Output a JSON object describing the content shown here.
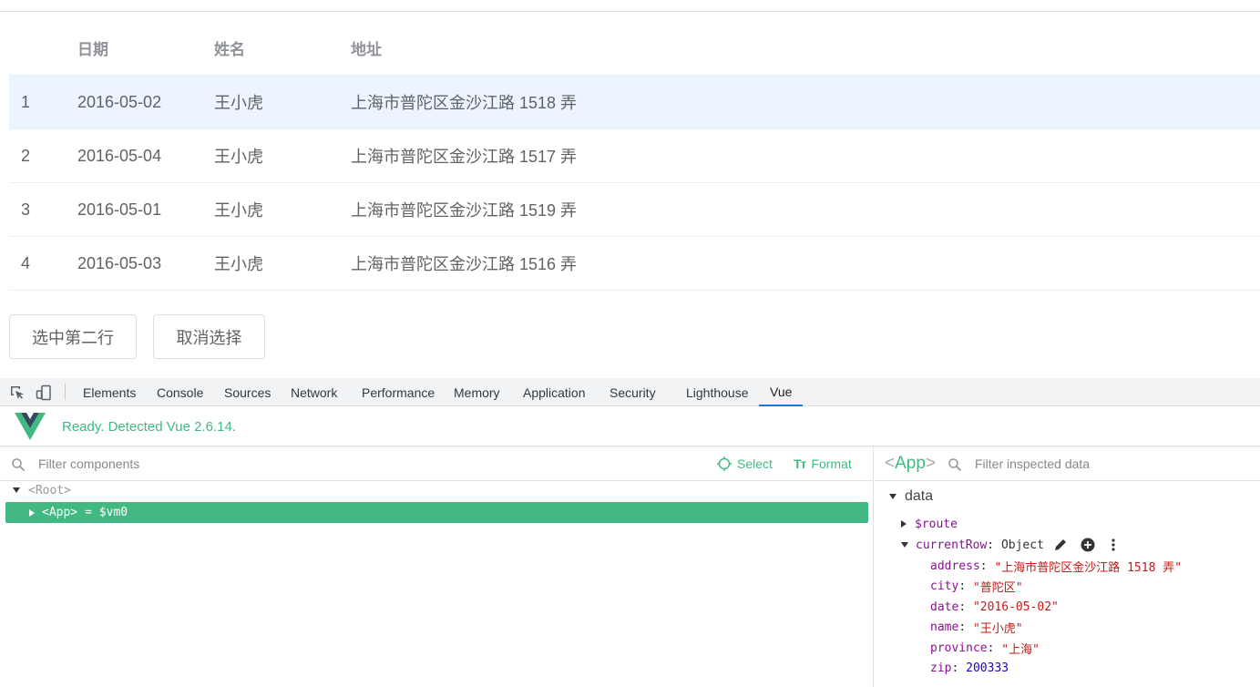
{
  "table": {
    "headers": {
      "date": "日期",
      "name": "姓名",
      "address": "地址"
    },
    "rows": [
      {
        "idx": "1",
        "date": "2016-05-02",
        "name": "王小虎",
        "address": "上海市普陀区金沙江路 1518 弄"
      },
      {
        "idx": "2",
        "date": "2016-05-04",
        "name": "王小虎",
        "address": "上海市普陀区金沙江路 1517 弄"
      },
      {
        "idx": "3",
        "date": "2016-05-01",
        "name": "王小虎",
        "address": "上海市普陀区金沙江路 1519 弄"
      },
      {
        "idx": "4",
        "date": "2016-05-03",
        "name": "王小虎",
        "address": "上海市普陀区金沙江路 1516 弄"
      }
    ],
    "current_row_index": 0
  },
  "buttons": {
    "select_second": "选中第二行",
    "clear_selection": "取消选择"
  },
  "devtools": {
    "tabs": [
      "Elements",
      "Console",
      "Sources",
      "Network",
      "Performance",
      "Memory",
      "Application",
      "Security",
      "Lighthouse",
      "Vue"
    ],
    "active_tab": "Vue"
  },
  "vue": {
    "status": "Ready. Detected Vue 2.6.14.",
    "accent_color": "#42b983",
    "components": {
      "filter_placeholder": "Filter components",
      "select_label": "Select",
      "format_label": "Format",
      "root_tag": "<Root>",
      "app_tag": "<App>",
      "app_ref": "= $vm0"
    },
    "inspector": {
      "title_open": "<",
      "title_name": "App",
      "title_close": ">",
      "filter_placeholder": "Filter inspected data",
      "section": "data",
      "route_key": "$route",
      "current_row_key": "currentRow",
      "current_row_type": "Object",
      "fields": [
        {
          "key": "address",
          "value": "\"上海市普陀区金沙江路 1518 弄\"",
          "kind": "str"
        },
        {
          "key": "city",
          "value": "\"普陀区\"",
          "kind": "str"
        },
        {
          "key": "date",
          "value": "\"2016-05-02\"",
          "kind": "str"
        },
        {
          "key": "name",
          "value": "\"王小虎\"",
          "kind": "str"
        },
        {
          "key": "province",
          "value": "\"上海\"",
          "kind": "str"
        },
        {
          "key": "zip",
          "value": "200333",
          "kind": "num"
        }
      ]
    }
  }
}
